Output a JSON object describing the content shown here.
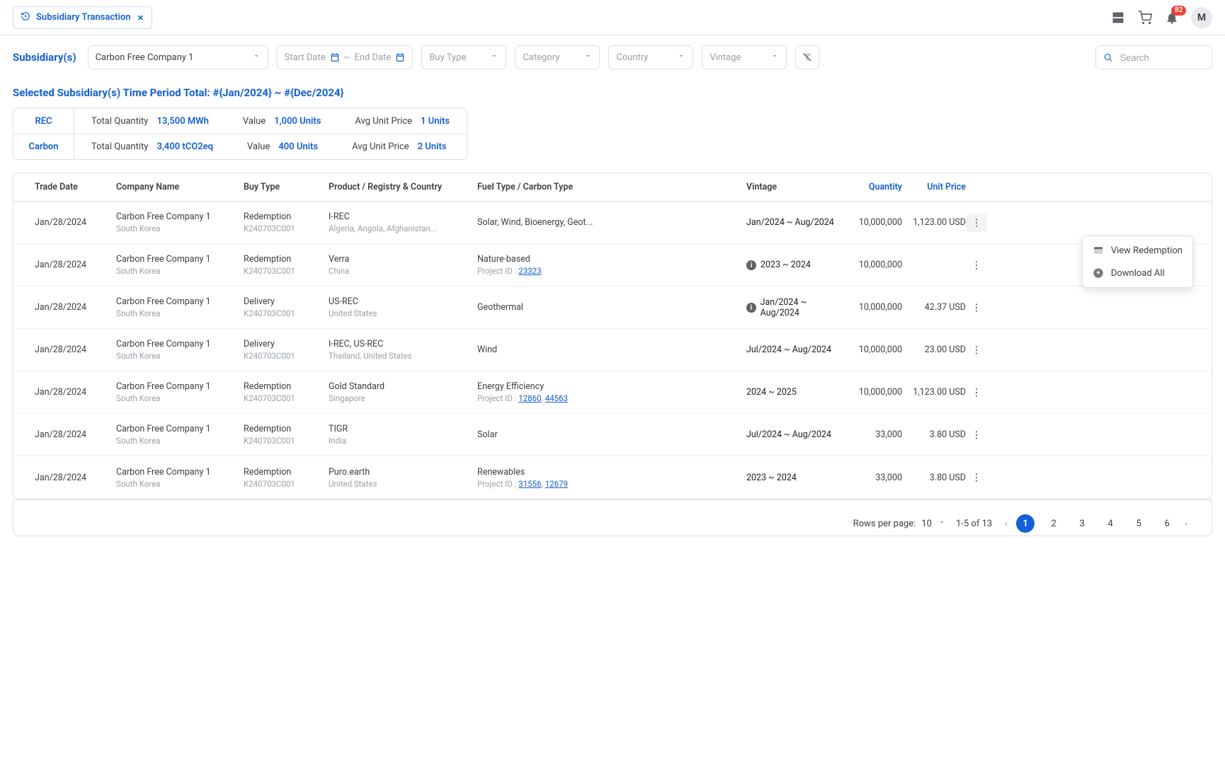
{
  "tab": {
    "title": "Subsidiary Transaction"
  },
  "topbar": {
    "notif_count": "82",
    "avatar_initial": "M"
  },
  "filters": {
    "label": "Subsidiary(s)",
    "subsidiary_value": "Carbon Free Company 1",
    "start_date_placeholder": "Start Date",
    "end_date_placeholder": "End Date",
    "buy_type_placeholder": "Buy Type",
    "category_placeholder": "Category",
    "country_placeholder": "Country",
    "vintage_placeholder": "Vintage",
    "search_placeholder": "Search"
  },
  "summary_title": "Selected Subsidiary(s) Time Period Total: #{Jan/2024} ~ #{Dec/2024}",
  "summary": {
    "rows": [
      {
        "category": "REC",
        "total_qty_label": "Total Quantity",
        "total_qty_value": "13,500 MWh",
        "value_label": "Value",
        "value_value": "1,000 Units",
        "avg_label": "Avg Unit Price",
        "avg_value": "1 Units"
      },
      {
        "category": "Carbon",
        "total_qty_label": "Total Quantity",
        "total_qty_value": "3,400 tCO2eq",
        "value_label": "Value",
        "value_value": "400 Units",
        "avg_label": "Avg Unit Price",
        "avg_value": "2 Units"
      }
    ]
  },
  "table": {
    "headers": {
      "trade_date": "Trade Date",
      "company": "Company Name",
      "buy_type": "Buy Type",
      "product": "Product / Registry & Country",
      "fuel": "Fuel Type / Carbon Type",
      "vintage": "Vintage",
      "qty": "Quantity",
      "price": "Unit Price"
    },
    "rows": [
      {
        "trade_date": "Jan/28/2024",
        "company": "Carbon Free Company 1",
        "company_sub": "South Korea",
        "buy_type": "Redemption",
        "buy_code": "K240703C001",
        "product": "I-REC",
        "product_sub": "Algeria, Angola, Afghanistan...",
        "fuel": "Solar, Wind, Bioenergy, Geot...",
        "project_label": "",
        "project_ids": [],
        "vintage": "Jan/2024 ~ Aug/2024",
        "vintage_info": false,
        "qty": "10,000,000",
        "price": "1,123.00 USD",
        "menu_open": true
      },
      {
        "trade_date": "Jan/28/2024",
        "company": "Carbon Free Company 1",
        "company_sub": "South Korea",
        "buy_type": "Redemption",
        "buy_code": "K240703C001",
        "product": "Verra",
        "product_sub": "China",
        "fuel": "Nature-based",
        "project_label": "Project ID :",
        "project_ids": [
          "23323"
        ],
        "vintage": "2023 ~ 2024",
        "vintage_info": true,
        "qty": "10,000,000",
        "price": "",
        "menu_open": false
      },
      {
        "trade_date": "Jan/28/2024",
        "company": "Carbon Free Company 1",
        "company_sub": "South Korea",
        "buy_type": "Delivery",
        "buy_code": "K240703C001",
        "product": "US-REC",
        "product_sub": "United States",
        "fuel": "Geothermal",
        "project_label": "",
        "project_ids": [],
        "vintage": "Jan/2024 ~ Aug/2024",
        "vintage_info": true,
        "qty": "10,000,000",
        "price": "42.37 USD",
        "menu_open": false
      },
      {
        "trade_date": "Jan/28/2024",
        "company": "Carbon Free Company 1",
        "company_sub": "South Korea",
        "buy_type": "Delivery",
        "buy_code": "K240703C001",
        "product": "I-REC, US-REC",
        "product_sub": "Thailand, United States",
        "fuel": "Wind",
        "project_label": "",
        "project_ids": [],
        "vintage": "Jul/2024 ~ Aug/2024",
        "vintage_info": false,
        "qty": "10,000,000",
        "price": "23.00 USD",
        "menu_open": false
      },
      {
        "trade_date": "Jan/28/2024",
        "company": "Carbon Free Company 1",
        "company_sub": "South Korea",
        "buy_type": "Redemption",
        "buy_code": "K240703C001",
        "product": "Gold Standard",
        "product_sub": "Singapore",
        "fuel": "Energy Efficiency",
        "project_label": "Project ID :",
        "project_ids": [
          "12860",
          "44563"
        ],
        "vintage": "2024 ~ 2025",
        "vintage_info": false,
        "qty": "10,000,000",
        "price": "1,123.00 USD",
        "menu_open": false
      },
      {
        "trade_date": "Jan/28/2024",
        "company": "Carbon Free Company 1",
        "company_sub": "South Korea",
        "buy_type": "Redemption",
        "buy_code": "K240703C001",
        "product": "TIGR",
        "product_sub": "India",
        "fuel": "Solar",
        "project_label": "",
        "project_ids": [],
        "vintage": "Jul/2024 ~ Aug/2024",
        "vintage_info": false,
        "qty": "33,000",
        "price": "3.80 USD",
        "menu_open": false
      },
      {
        "trade_date": "Jan/28/2024",
        "company": "Carbon Free Company 1",
        "company_sub": "South Korea",
        "buy_type": "Redemption",
        "buy_code": "K240703C001",
        "product": "Puro.earth",
        "product_sub": "United States",
        "fuel": "Renewables",
        "project_label": "Project ID :",
        "project_ids": [
          "31556",
          "12679"
        ],
        "vintage": "2023 ~ 2024",
        "vintage_info": false,
        "qty": "33,000",
        "price": "3.80 USD",
        "menu_open": false
      }
    ]
  },
  "row_menu": {
    "view": "View Redemption",
    "download": "Download All"
  },
  "pagination": {
    "rows_label": "Rows per page:",
    "rows_value": "10",
    "range": "1-5 of 13",
    "pages": [
      "1",
      "2",
      "3",
      "4",
      "5",
      "6"
    ],
    "current": "1"
  }
}
